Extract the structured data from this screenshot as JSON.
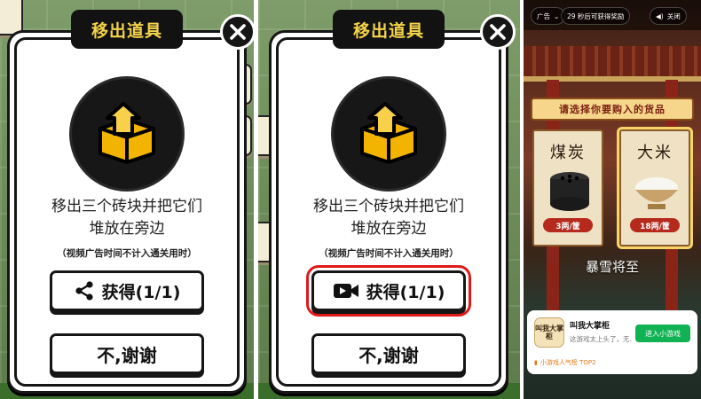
{
  "panels": [
    {
      "title": "移出道具",
      "description_line1": "移出三个砖块并把它们",
      "description_line2": "堆放在旁边",
      "note": "（视频广告时间不计入通关用时）",
      "get_button_label": "获得(1/1)",
      "get_button_icon": "share-icon",
      "decline_button_label": "不,谢谢"
    },
    {
      "title": "移出道具",
      "description_line1": "移出三个砖块并把它们",
      "description_line2": "堆放在旁边",
      "note": "（视频广告时间不计入通关用时）",
      "get_button_label": "获得(1/1)",
      "get_button_icon": "video-camera-icon",
      "get_button_highlight_color": "#e01919",
      "decline_button_label": "不,谢谢"
    }
  ],
  "ad": {
    "ad_label": "广告",
    "countdown": "29 秒后可获得奖励",
    "close_label": "关闭",
    "banner": "请选择你要购入的货品",
    "items": [
      {
        "name": "煤炭",
        "price": "3两/筐",
        "selected": false
      },
      {
        "name": "大米",
        "price": "18两/筐",
        "selected": true
      }
    ],
    "caption": "暴雪将至",
    "app": {
      "icon_text": "叫我大掌柜",
      "name": "叫我大掌柜",
      "desc": "这游戏太上头了，无…",
      "button": "进入小游戏",
      "rank": "小游戏人气榜 TOP2"
    }
  },
  "colors": {
    "title_text": "#f3d34a",
    "dialog_border": "#161616",
    "highlight": "#e01919",
    "ad_button": "#11b254",
    "price_tag": "#b52a1c"
  }
}
